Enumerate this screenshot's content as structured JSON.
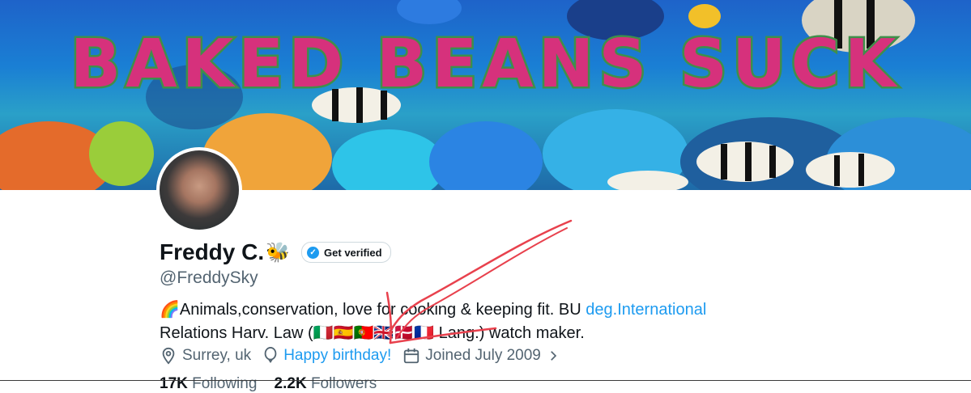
{
  "banner": {
    "text": "BAKED BEANS SUCK"
  },
  "profile": {
    "name": "Freddy C.",
    "name_emoji": "🐝",
    "verify_label": "Get verified",
    "handle": "@FreddySky",
    "bio": {
      "part1": "🌈Animals,conservation, love for cooking & keeping fit. BU ",
      "link": "deg.International",
      "part2": "Relations Harv. Law (🇮🇹🇪🇸🇵🇹🇬🇧🇩🇰🇫🇷 Lang.) watch maker."
    },
    "location": "Surrey, uk",
    "birthday": "Happy birthday!",
    "joined": "Joined July 2009",
    "following_count": "17K",
    "following_label": "Following",
    "followers_count": "2.2K",
    "followers_label": "Followers"
  },
  "colors": {
    "accent": "#1d9bf0",
    "annotation": "#e8414d",
    "banner_text": "#d6317c"
  }
}
